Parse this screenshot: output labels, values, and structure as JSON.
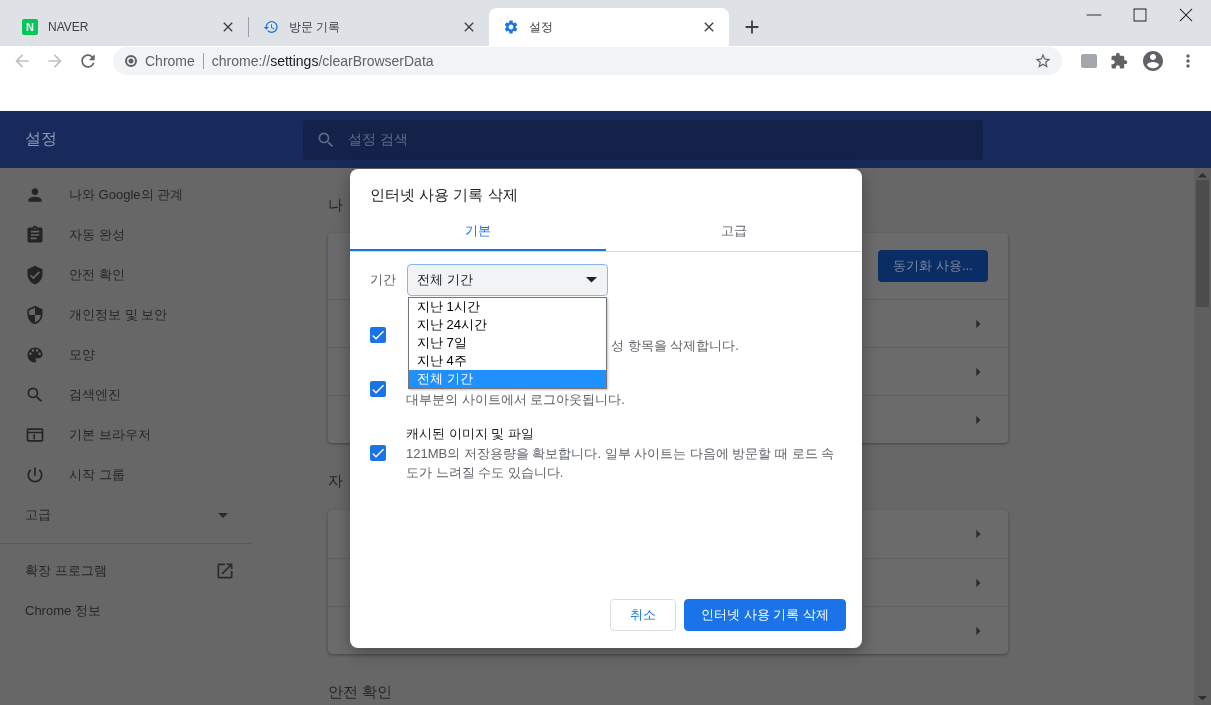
{
  "browser": {
    "tabs": [
      {
        "title": "NAVER",
        "badge": "N",
        "selected": false
      },
      {
        "title": "방문 기록",
        "selected": false
      },
      {
        "title": "설정",
        "selected": true
      }
    ],
    "address_bar": {
      "site_label": "Chrome",
      "url": "chrome://**settings**/clearBrowserData"
    }
  },
  "settings": {
    "title": "설정",
    "search_placeholder": "설정 검색",
    "sidebar": {
      "items": [
        {
          "label": "나와 Google의 관계"
        },
        {
          "label": "자동 완성"
        },
        {
          "label": "안전 확인"
        },
        {
          "label": "개인정보 및 보안"
        },
        {
          "label": "모양"
        },
        {
          "label": "검색엔진"
        },
        {
          "label": "기본 브라우저"
        },
        {
          "label": "시작 그룹"
        }
      ],
      "advanced": {
        "label": "고급",
        "expanded": false
      },
      "links": [
        {
          "label": "확장 프로그램",
          "external": true
        },
        {
          "label": "Chrome 정보",
          "external": false
        }
      ]
    },
    "sections": [
      {
        "heading": "나",
        "rows": [
          {
            "kind": "sync",
            "button": "동기화 사용..."
          },
          {
            "kind": "link"
          },
          {
            "kind": "link"
          },
          {
            "kind": "link"
          }
        ]
      },
      {
        "heading": "자",
        "rows": [
          {
            "kind": "link"
          },
          {
            "kind": "link"
          },
          {
            "kind": "link"
          }
        ]
      },
      {
        "heading": "안전 확인"
      }
    ]
  },
  "dialog": {
    "title": "인터넷 사용 기록 삭제",
    "tabs": [
      {
        "label": "기본",
        "selected": true
      },
      {
        "label": "고급",
        "selected": false
      }
    ],
    "period": {
      "label": "기간",
      "value": "전체 기간",
      "expanded": true,
      "options": [
        {
          "label": "지난 1시간",
          "selected": false
        },
        {
          "label": "지난 24시간",
          "selected": false
        },
        {
          "label": "지난 7일",
          "selected": false
        },
        {
          "label": "지난 4주",
          "selected": false
        },
        {
          "label": "전체 기간",
          "selected": true
        }
      ]
    },
    "items": [
      {
        "checked": true,
        "description": "성 항목을 삭제합니다."
      },
      {
        "checked": true,
        "description": "대부분의 사이트에서 로그아웃됩니다."
      },
      {
        "checked": true,
        "title": "캐시된 이미지 및 파일",
        "description": "121MB의 저장용량을 확보합니다. 일부 사이트는 다음에 방문할 때 로드 속도가 느려질 수도 있습니다."
      }
    ],
    "buttons": [
      {
        "label": "취소",
        "kind": "secondary"
      },
      {
        "label": "인터넷 사용 기록 삭제",
        "kind": "primary"
      }
    ]
  }
}
